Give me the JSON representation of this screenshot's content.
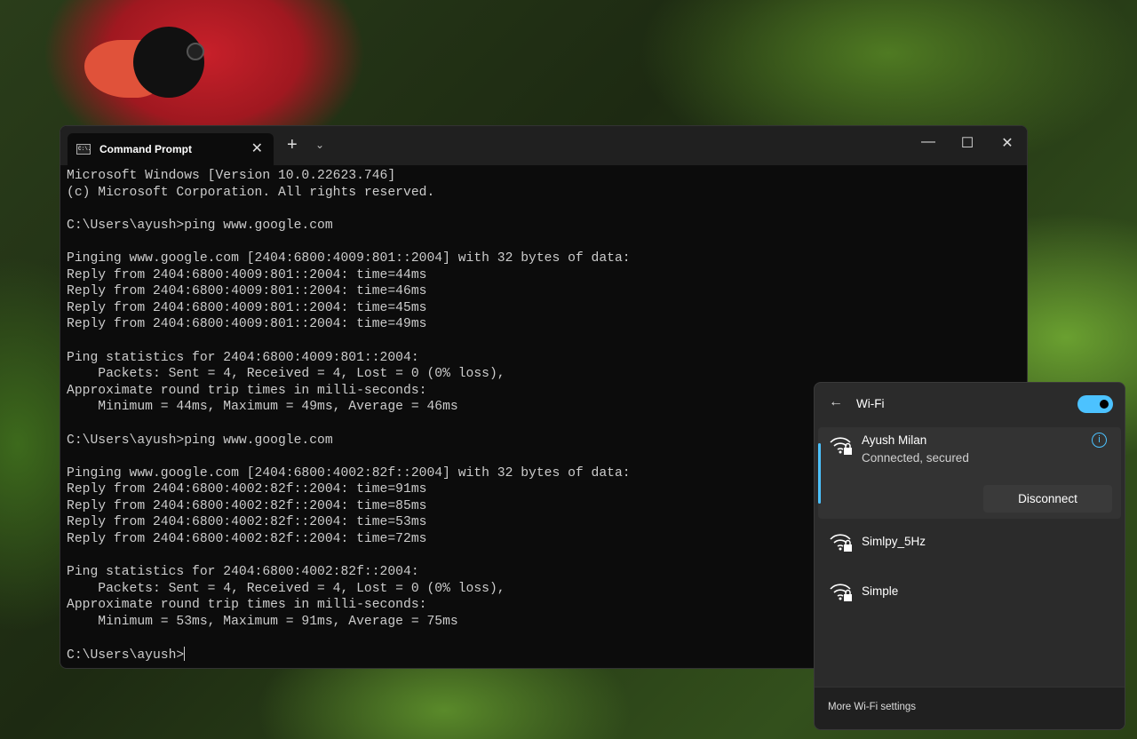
{
  "terminal": {
    "tab_title": "Command Prompt",
    "tab_icon_text": "C:\\.",
    "lines": [
      "Microsoft Windows [Version 10.0.22623.746]",
      "(c) Microsoft Corporation. All rights reserved.",
      "",
      "C:\\Users\\ayush>ping www.google.com",
      "",
      "Pinging www.google.com [2404:6800:4009:801::2004] with 32 bytes of data:",
      "Reply from 2404:6800:4009:801::2004: time=44ms",
      "Reply from 2404:6800:4009:801::2004: time=46ms",
      "Reply from 2404:6800:4009:801::2004: time=45ms",
      "Reply from 2404:6800:4009:801::2004: time=49ms",
      "",
      "Ping statistics for 2404:6800:4009:801::2004:",
      "    Packets: Sent = 4, Received = 4, Lost = 0 (0% loss),",
      "Approximate round trip times in milli-seconds:",
      "    Minimum = 44ms, Maximum = 49ms, Average = 46ms",
      "",
      "C:\\Users\\ayush>ping www.google.com",
      "",
      "Pinging www.google.com [2404:6800:4002:82f::2004] with 32 bytes of data:",
      "Reply from 2404:6800:4002:82f::2004: time=91ms",
      "Reply from 2404:6800:4002:82f::2004: time=85ms",
      "Reply from 2404:6800:4002:82f::2004: time=53ms",
      "Reply from 2404:6800:4002:82f::2004: time=72ms",
      "",
      "Ping statistics for 2404:6800:4002:82f::2004:",
      "    Packets: Sent = 4, Received = 4, Lost = 0 (0% loss),",
      "Approximate round trip times in milli-seconds:",
      "    Minimum = 53ms, Maximum = 91ms, Average = 75ms",
      "",
      "C:\\Users\\ayush>"
    ]
  },
  "wifi": {
    "title": "Wi-Fi",
    "enabled": true,
    "accent": "#4cc2ff",
    "connected": {
      "name": "Ayush Milan",
      "status": "Connected, secured",
      "action": "Disconnect"
    },
    "networks": [
      {
        "name": "Simlpy_5Hz"
      },
      {
        "name": "Simple"
      }
    ],
    "footer": "More Wi-Fi settings"
  }
}
